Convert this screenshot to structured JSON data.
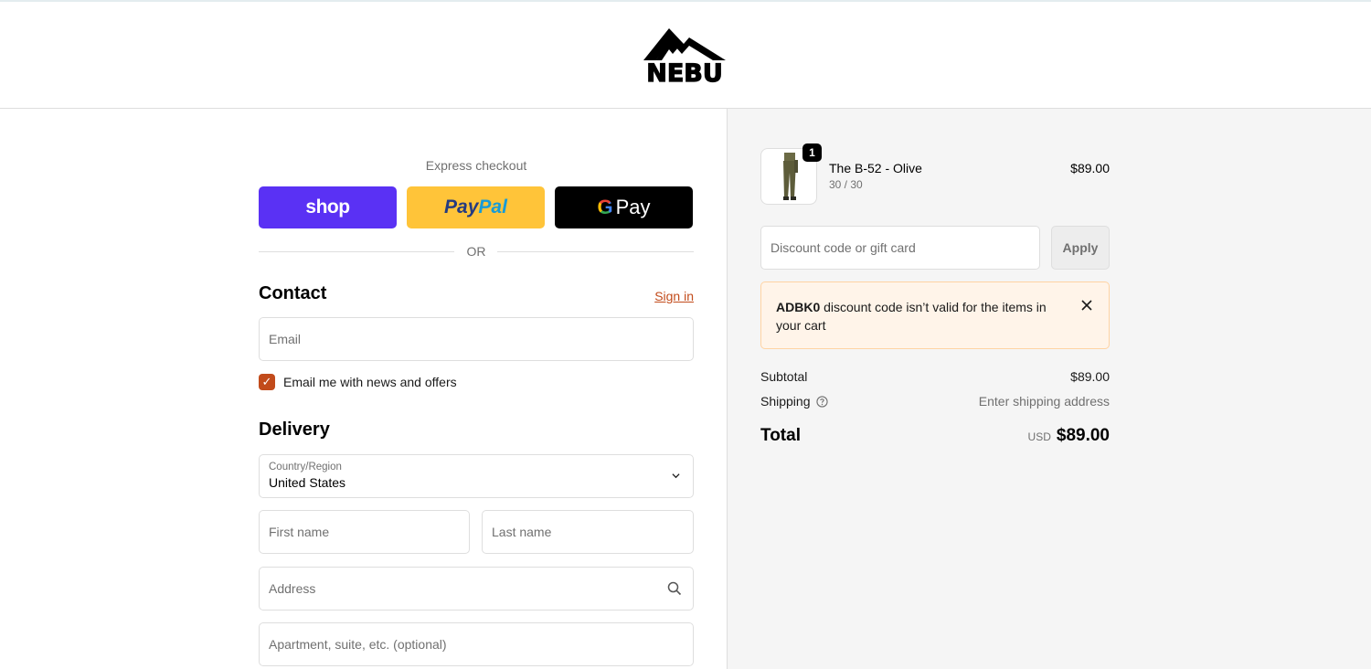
{
  "brand": {
    "logo_text": "NEBU"
  },
  "express": {
    "label": "Express checkout",
    "shop_label": "shop",
    "paypal_label_1": "Pay",
    "paypal_label_2": "Pal",
    "gpay_g": "G",
    "gpay_label": "Pay",
    "or_label": "OR"
  },
  "contact": {
    "title": "Contact",
    "signin_label": "Sign in",
    "email_placeholder": "Email",
    "newsletter_checked": true,
    "newsletter_label": "Email me with news and offers"
  },
  "delivery": {
    "title": "Delivery",
    "country_label": "Country/Region",
    "country_value": "United States",
    "first_name_placeholder": "First name",
    "last_name_placeholder": "Last name",
    "address_placeholder": "Address",
    "apartment_placeholder": "Apartment, suite, etc. (optional)"
  },
  "order": {
    "item": {
      "name": "The B-52 - Olive",
      "variant": "30 / 30",
      "price": "$89.00",
      "quantity": "1"
    },
    "discount_placeholder": "Discount code or gift card",
    "apply_label": "Apply",
    "alert": {
      "code": "ADBK0",
      "message": " discount code isn’t valid for the items in your cart"
    },
    "subtotal_label": "Subtotal",
    "subtotal_value": "$89.00",
    "shipping_label": "Shipping",
    "shipping_value": "Enter shipping address",
    "total_label": "Total",
    "total_currency": "USD",
    "total_value": "$89.00"
  },
  "colors": {
    "shop": "#5a31f4",
    "paypal": "#ffc439",
    "gpay": "#000000",
    "accent": "#c24b1b",
    "alert_bg": "#fff4e9"
  }
}
